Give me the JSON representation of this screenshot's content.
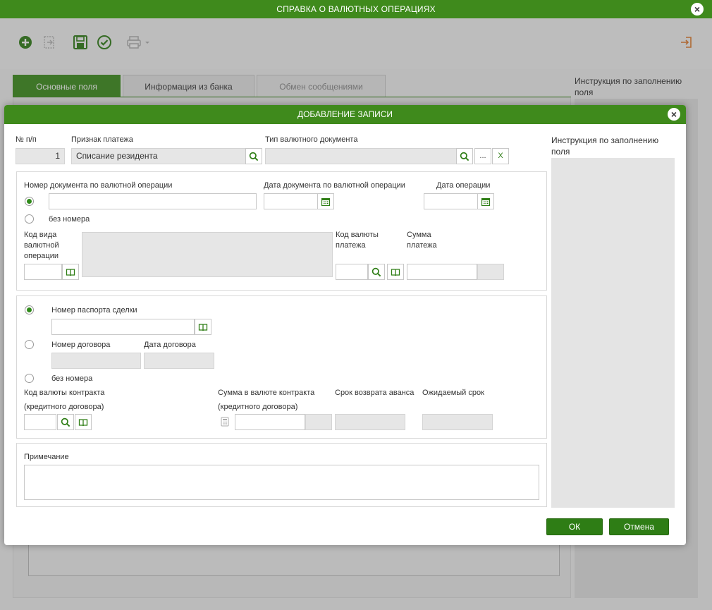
{
  "window": {
    "title": "СПРАВКА О ВАЛЮТНЫХ ОПЕРАЦИЯХ"
  },
  "outer": {
    "tabs": [
      {
        "label": "Основные поля"
      },
      {
        "label": "Информация из банка"
      },
      {
        "label": "Обмен сообщениями"
      }
    ],
    "instruction_label": "Инструкция по заполнению поля"
  },
  "dialog": {
    "title": "ДОБАВЛЕНИЕ ЗАПИСИ",
    "row_number": {
      "label": "№ п/п",
      "value": "1"
    },
    "payment_sign": {
      "label": "Признак платежа",
      "value": "Списание резидента"
    },
    "currency_doc_type": {
      "label": "Тип валютного документа",
      "value": "",
      "ellipsis": "...",
      "clear": "X"
    },
    "section1": {
      "doc_number_label": "Номер документа по валютной операции",
      "doc_date_label": "Дата документа по валютной операции",
      "op_date_label": "Дата операции",
      "no_number_label": "без номера",
      "op_code_label": "Код вида валютной операции",
      "currency_code_label": "Код валюты платежа",
      "amount_label": "Сумма платежа"
    },
    "section2": {
      "passport_label": "Номер паспорта сделки",
      "contract_number_label": "Номер договора",
      "contract_date_label": "Дата договора",
      "no_number_label": "без номера",
      "contract_currency_label": "Код валюты контракта",
      "contract_currency_label2": "(кредитного договора)",
      "contract_amount_label": "Сумма в валюте контракта",
      "contract_amount_label2": "(кредитного договора)",
      "advance_return_label": "Срок возврата аванса",
      "expected_term_label": "Ожидаемый срок"
    },
    "note_label": "Примечание",
    "instruction_label": "Инструкция по заполнению поля",
    "ok_label": "ОК",
    "cancel_label": "Отмена"
  }
}
